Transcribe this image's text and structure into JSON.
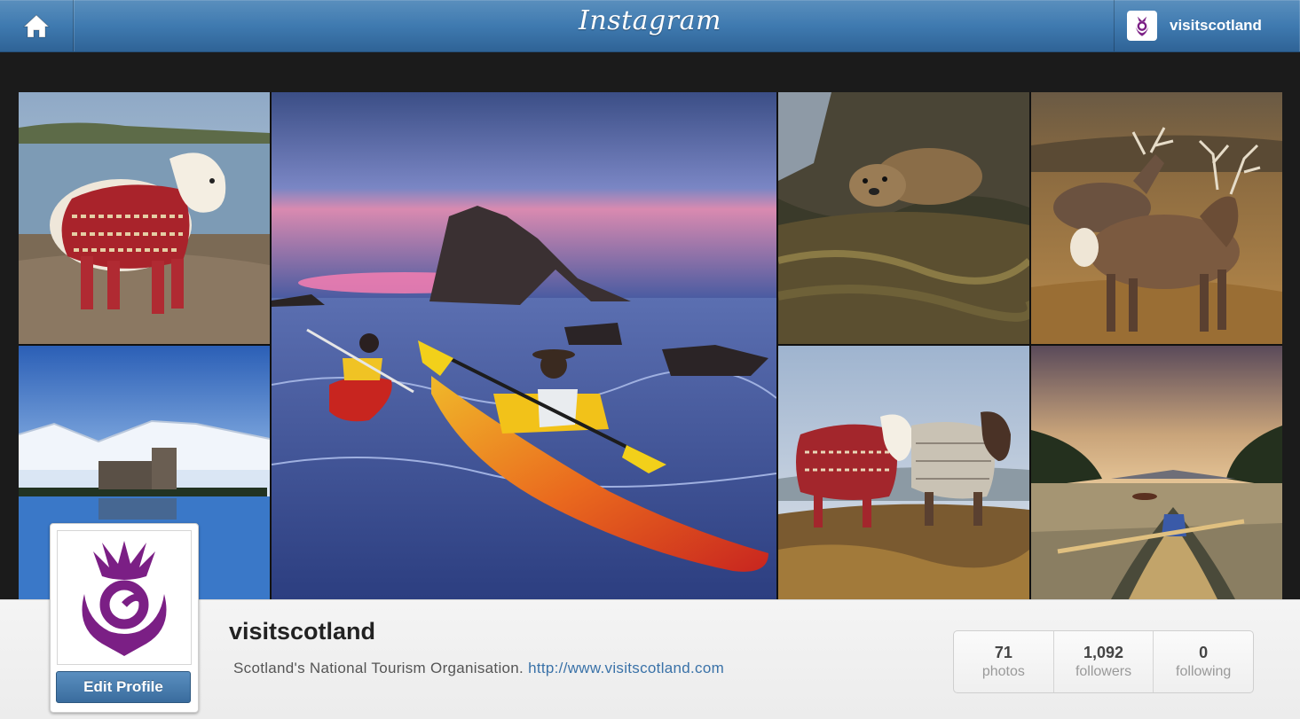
{
  "header": {
    "brand": "Instagram",
    "user_label": "visitscotland",
    "home_icon": "home-icon"
  },
  "grid": {
    "photos": [
      {
        "subject": "shetland-pony-in-cardigan"
      },
      {
        "subject": "kayakers-at-bow-fiddle-rock"
      },
      {
        "subject": "otter-on-seaweed"
      },
      {
        "subject": "red-deer-stags"
      },
      {
        "subject": "castle-and-snowy-mountains"
      },
      {
        "subject": "two-ponies-in-jumpers"
      },
      {
        "subject": "canoe-on-loch"
      }
    ]
  },
  "profile": {
    "username": "visitscotland",
    "bio": "Scotland's National Tourism Organisation.",
    "link": "http://www.visitscotland.com",
    "edit_button": "Edit Profile",
    "avatar_icon": "thistle-logo-icon",
    "brand_color": "#7b1f85"
  },
  "stats": [
    {
      "value": "71",
      "label": "photos"
    },
    {
      "value": "1,092",
      "label": "followers"
    },
    {
      "value": "0",
      "label": "following"
    }
  ]
}
